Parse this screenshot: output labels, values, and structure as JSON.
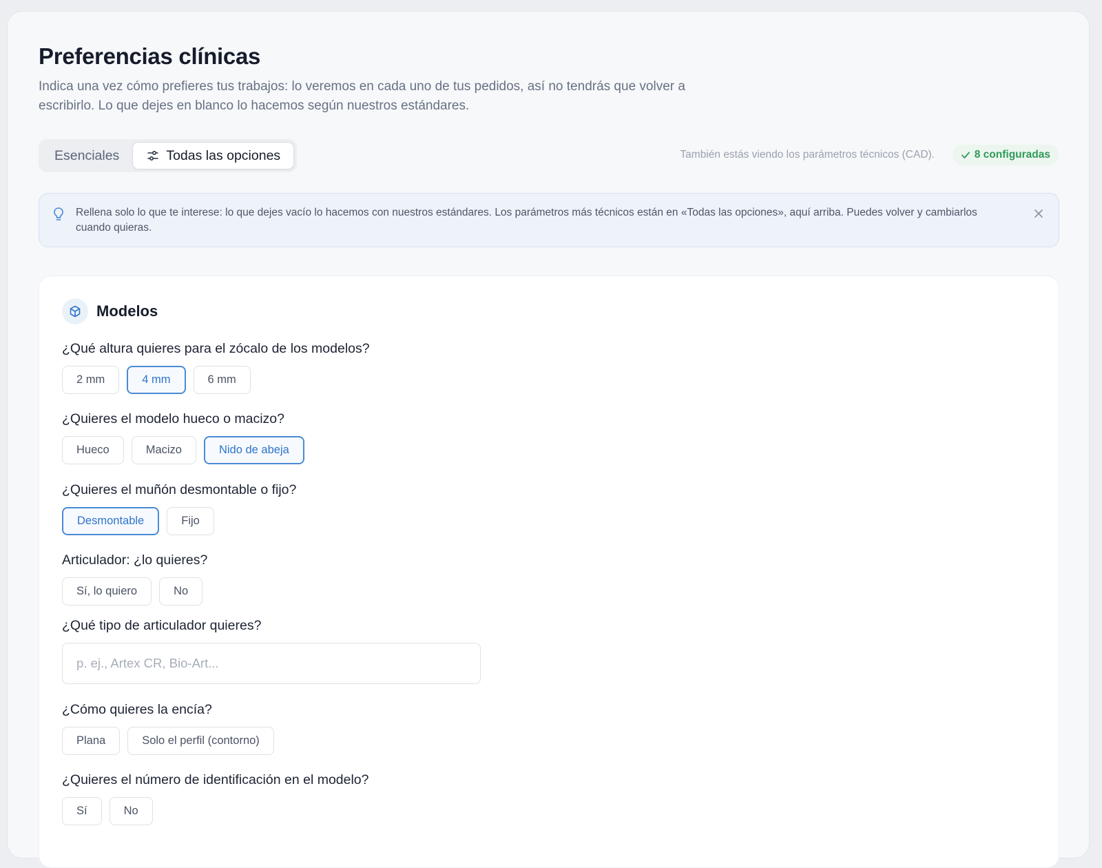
{
  "header": {
    "title": "Preferencias clínicas",
    "subtitle": "Indica una vez cómo prefieres tus trabajos: lo veremos en cada uno de tus pedidos, así no tendrás que volver a escribirlo. Lo que dejes en blanco lo hacemos según nuestros estándares."
  },
  "tabs": [
    {
      "label": "Esenciales",
      "active": false
    },
    {
      "label": "Todas las opciones",
      "active": true,
      "icon": "sliders-icon"
    }
  ],
  "cad_note": "También estás viendo los parámetros técnicos (CAD).",
  "configured_badge": {
    "label": "8 configuradas",
    "icon": "check-icon",
    "color": "#2f9a59"
  },
  "info_banner": {
    "icon": "lightbulb-icon",
    "text": "Rellena solo lo que te interese: lo que dejes vacío lo hacemos con nuestros estándares. Los parámetros más técnicos están en «Todas las opciones», aquí arriba. Puedes volver y cambiarlos cuando quieras.",
    "close_icon": "close-icon"
  },
  "section": {
    "title": "Modelos",
    "icon": "cube-icon",
    "questions": [
      {
        "label": "¿Qué altura quieres para el zócalo de los modelos?",
        "options": [
          "2 mm",
          "4 mm",
          "6 mm"
        ],
        "selected": "4 mm"
      },
      {
        "label": "¿Quieres el modelo hueco o macizo?",
        "options": [
          "Hueco",
          "Macizo",
          "Nido de abeja"
        ],
        "selected": "Nido de abeja"
      },
      {
        "label": "¿Quieres el muñón desmontable o fijo?",
        "options": [
          "Desmontable",
          "Fijo"
        ],
        "selected": "Desmontable"
      },
      {
        "label": "Articulador: ¿lo quieres?",
        "options": [
          "Sí, lo quiero",
          "No"
        ],
        "selected": null
      },
      {
        "label": "¿Qué tipo de articulador quieres?",
        "input_placeholder": "p. ej., Artex CR, Bio-Art...",
        "input_value": ""
      },
      {
        "label": "¿Cómo quieres la encía?",
        "options": [
          "Plana",
          "Solo el perfil (contorno)"
        ],
        "selected": null
      },
      {
        "label": "¿Quieres el número de identificación en el modelo?",
        "options": [
          "Sí",
          "No"
        ],
        "selected": null
      }
    ]
  },
  "colors": {
    "accent": "#2f74c9",
    "success": "#2f9a59"
  }
}
